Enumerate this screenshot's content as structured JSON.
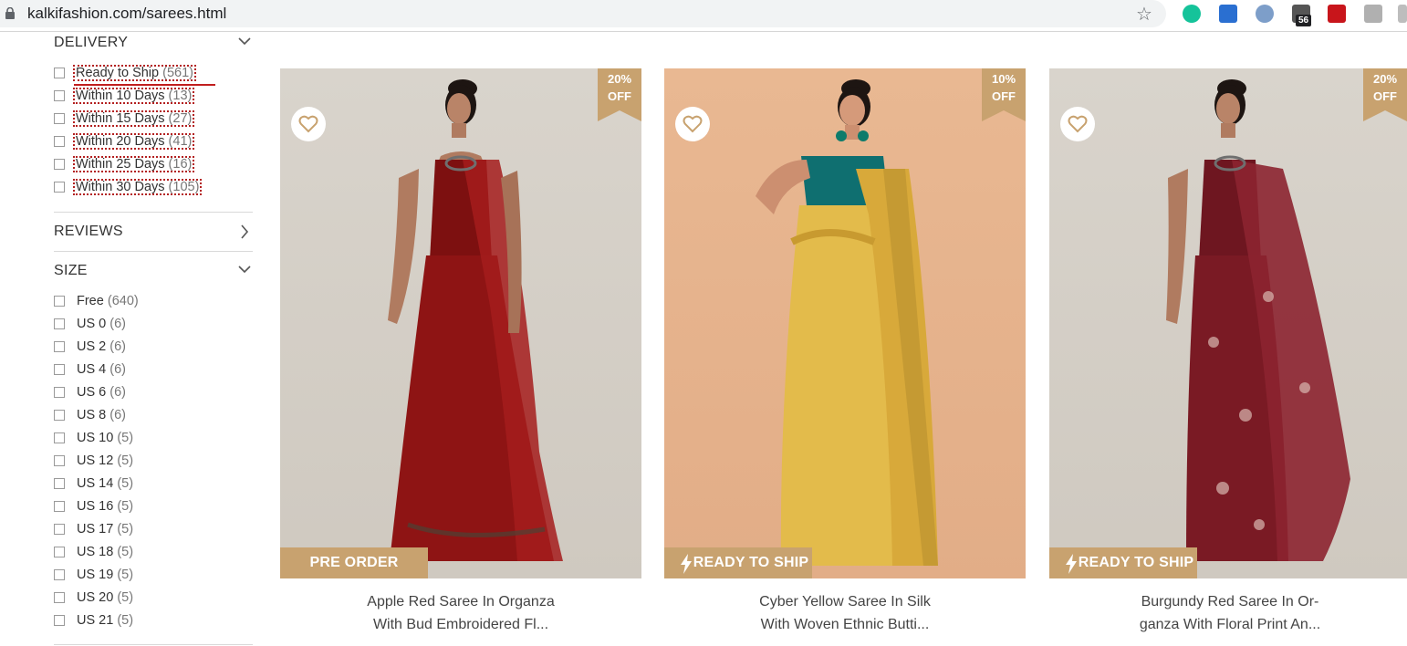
{
  "browser": {
    "url": "kalkifashion.com/sarees.html",
    "extension_badge": "56"
  },
  "sidebar": {
    "delivery": {
      "title": "DELIVERY",
      "items": [
        {
          "label": "Ready to Ship",
          "count": "(561)"
        },
        {
          "label": "Within 10 Days",
          "count": "(13)"
        },
        {
          "label": "Within 15 Days",
          "count": "(27)"
        },
        {
          "label": "Within 20 Days",
          "count": "(41)"
        },
        {
          "label": "Within 25 Days",
          "count": "(16)"
        },
        {
          "label": "Within 30 Days",
          "count": "(105)"
        }
      ]
    },
    "reviews": {
      "title": "REVIEWS"
    },
    "size": {
      "title": "SIZE",
      "items": [
        {
          "label": "Free",
          "count": "(640)"
        },
        {
          "label": "US 0",
          "count": "(6)"
        },
        {
          "label": "US 2",
          "count": "(6)"
        },
        {
          "label": "US 4",
          "count": "(6)"
        },
        {
          "label": "US 6",
          "count": "(6)"
        },
        {
          "label": "US 8",
          "count": "(6)"
        },
        {
          "label": "US 10",
          "count": "(5)"
        },
        {
          "label": "US 12",
          "count": "(5)"
        },
        {
          "label": "US 14",
          "count": "(5)"
        },
        {
          "label": "US 16",
          "count": "(5)"
        },
        {
          "label": "US 17",
          "count": "(5)"
        },
        {
          "label": "US 18",
          "count": "(5)"
        },
        {
          "label": "US 19",
          "count": "(5)"
        },
        {
          "label": "US 20",
          "count": "(5)"
        },
        {
          "label": "US 21",
          "count": "(5)"
        }
      ]
    }
  },
  "products": [
    {
      "discount_pct": "20%",
      "discount_off": "OFF",
      "ribbon": "PRE ORDER",
      "title_line1": "Apple Red Saree In Organza",
      "title_line2": "With Bud Embroidered Fl..."
    },
    {
      "discount_pct": "10%",
      "discount_off": "OFF",
      "ribbon": "READY TO SHIP",
      "title_line1": "Cyber Yellow Saree In Silk",
      "title_line2": "With Woven Ethnic Butti..."
    },
    {
      "discount_pct": "20%",
      "discount_off": "OFF",
      "ribbon": "READY TO SHIP",
      "title_line1": "Burgundy Red Saree In Or-",
      "title_line2": "ganza With Floral Print An..."
    }
  ],
  "colors": {
    "accent_tan": "#c8a26f",
    "saree_red": "#8e1414",
    "saree_yellow": "#e3bb4b",
    "saree_burgundy": "#7a1a24"
  }
}
